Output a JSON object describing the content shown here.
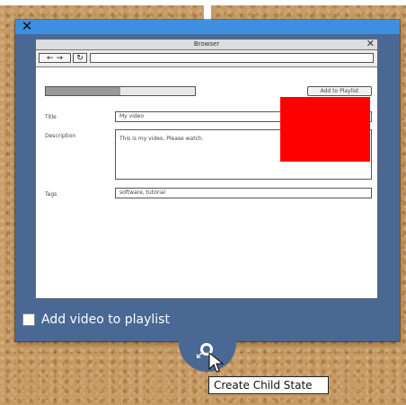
{
  "overlay": {
    "close_icon": "✕",
    "checkbox_label": "Add video to playlist",
    "checkbox_checked": false
  },
  "browser": {
    "title": "Browser",
    "close_icon": "✕",
    "nav": {
      "back": "←",
      "forward": "→",
      "refresh": "↻",
      "url": ""
    },
    "progress_fraction": 0.5,
    "add_button_label": "Add to Playlist",
    "fields": {
      "title_label": "Title",
      "title_value": "My video",
      "description_label": "Description",
      "description_value": "This is my video. Please watch.",
      "tags_label": "Tags",
      "tags_value": "software, tutorial"
    },
    "highlight_color": "#ff0000"
  },
  "tooltip": {
    "text": "Create Child State"
  },
  "icons": {
    "handle": "link-icon",
    "cursor": "mouse-pointer-icon"
  }
}
